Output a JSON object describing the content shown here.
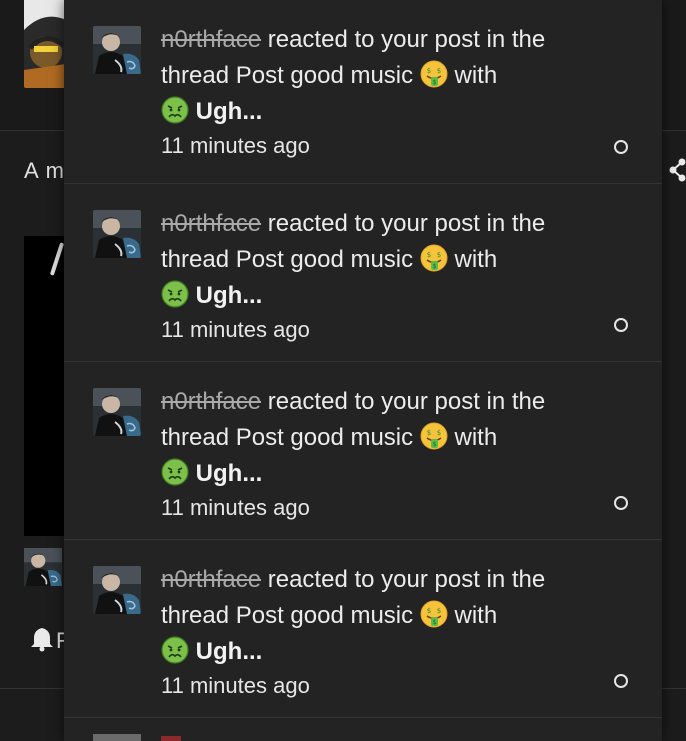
{
  "colors": {
    "page_bg": "#1c1c1c",
    "popup_bg": "#232323",
    "username_strikethrough": "#a9a9a9",
    "text": "#ececec"
  },
  "background": {
    "partial_title": "A m",
    "partial_label": "F",
    "share_icon": "share-icon",
    "bell_icon": "bell-icon"
  },
  "notifications": [
    {
      "username": "n0rthface",
      "action": " reacted to your post in the thread Post good music ",
      "thread_emoji": "money-mouth-face-emoji",
      "with": " with",
      "reaction_emoji": "nauseated-face-emoji",
      "reaction_label": "Ugh...",
      "time": "11 minutes ago",
      "read_state": "unread"
    },
    {
      "username": "n0rthface",
      "action": " reacted to your post in the thread Post good music ",
      "thread_emoji": "money-mouth-face-emoji",
      "with": " with",
      "reaction_emoji": "nauseated-face-emoji",
      "reaction_label": "Ugh...",
      "time": "11 minutes ago",
      "read_state": "unread"
    },
    {
      "username": "n0rthface",
      "action": " reacted to your post in the thread Post good music ",
      "thread_emoji": "money-mouth-face-emoji",
      "with": " with",
      "reaction_emoji": "nauseated-face-emoji",
      "reaction_label": "Ugh...",
      "time": "11 minutes ago",
      "read_state": "unread"
    },
    {
      "username": "n0rthface",
      "action": " reacted to your post in the thread Post good music ",
      "thread_emoji": "money-mouth-face-emoji",
      "with": " with",
      "reaction_emoji": "nauseated-face-emoji",
      "reaction_label": "Ugh...",
      "time": "11 minutes ago",
      "read_state": "unread"
    }
  ]
}
